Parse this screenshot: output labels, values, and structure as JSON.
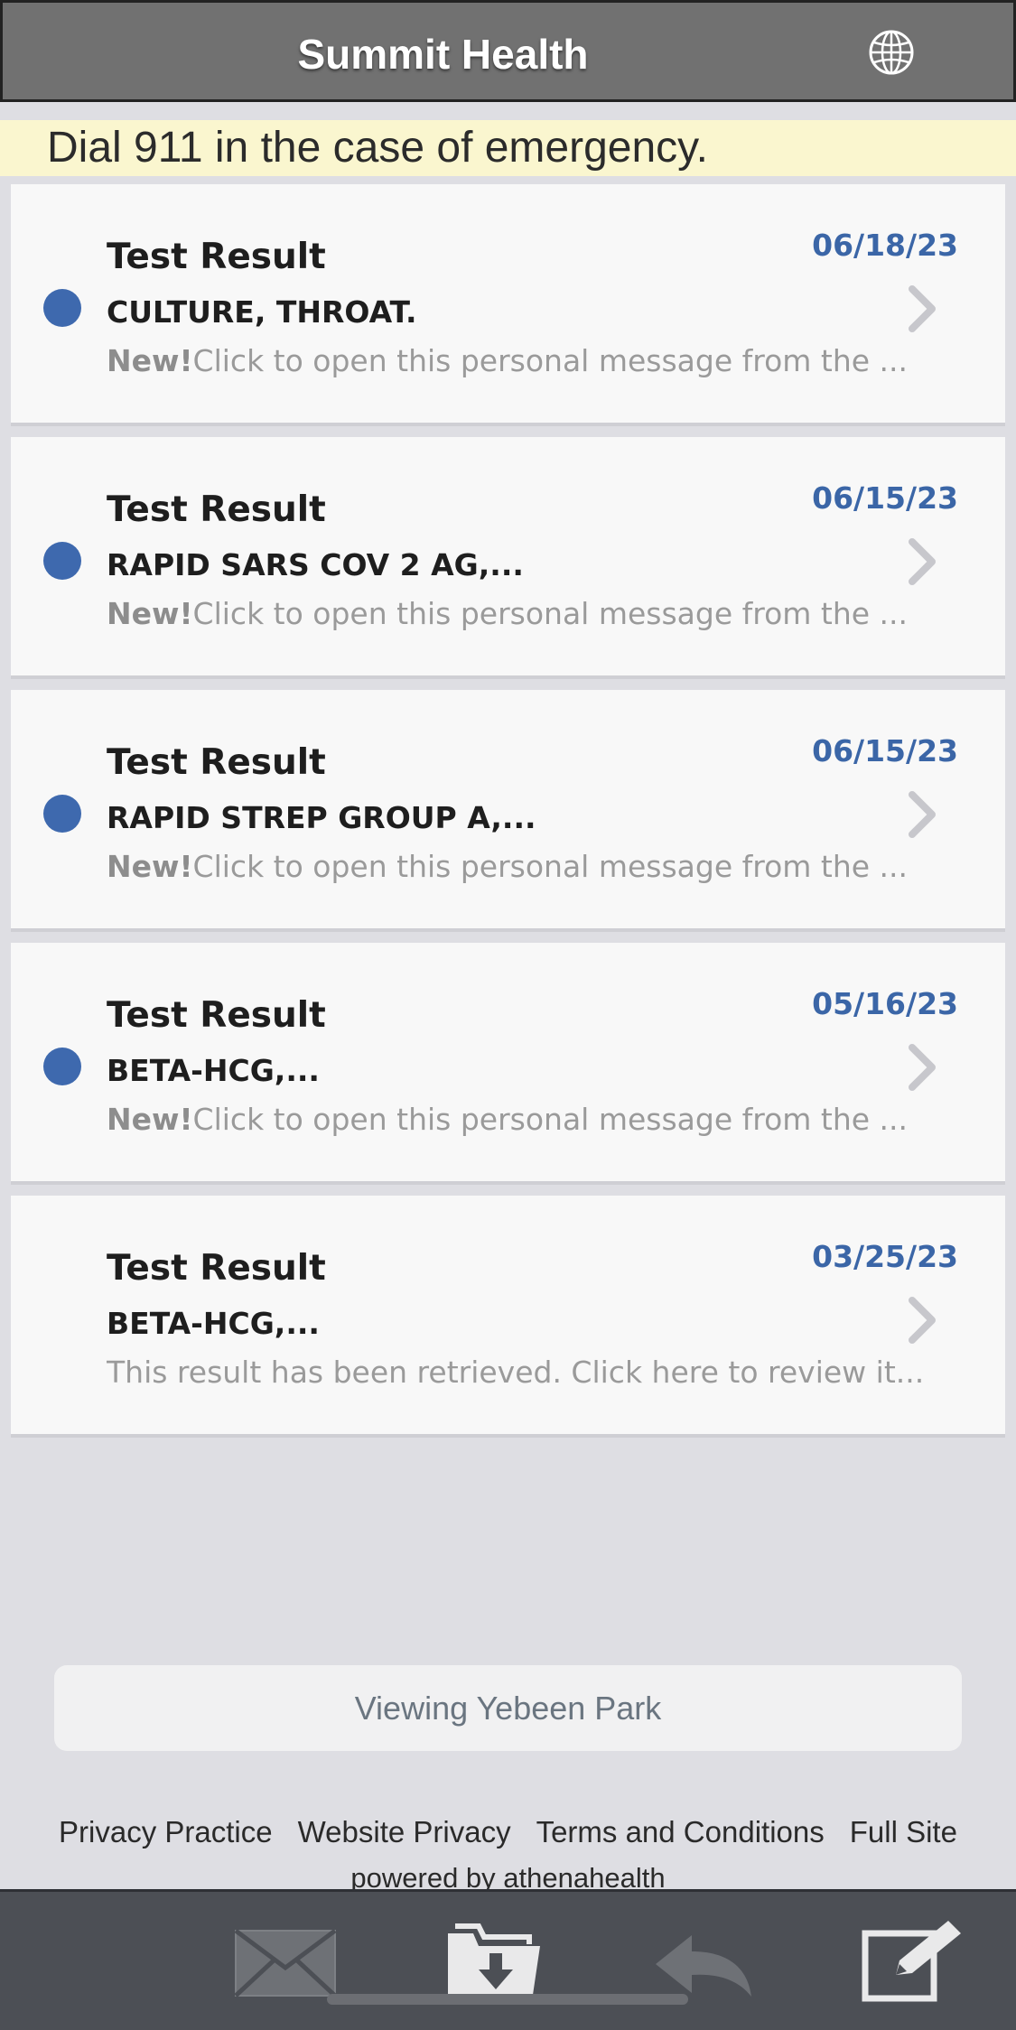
{
  "header": {
    "title": "Summit Health",
    "language_icon": "globe-icon"
  },
  "banner": {
    "text": "Dial 911 in the case of emergency."
  },
  "messages": [
    {
      "unread": true,
      "title": "Test Result",
      "subject": "CULTURE, THROAT.",
      "new_label": "New!",
      "preview": "Click to open this personal message from the ...",
      "date": "06/18/23"
    },
    {
      "unread": true,
      "title": "Test Result",
      "subject": "RAPID SARS COV 2 AG,...",
      "new_label": "New!",
      "preview": "Click to open this personal message from the ...",
      "date": "06/15/23"
    },
    {
      "unread": true,
      "title": "Test Result",
      "subject": "RAPID STREP GROUP A,...",
      "new_label": "New!",
      "preview": "Click to open this personal message from the ...",
      "date": "06/15/23"
    },
    {
      "unread": true,
      "title": "Test Result",
      "subject": "BETA-HCG,...",
      "new_label": "New!",
      "preview": "Click to open this personal message from the ...",
      "date": "05/16/23"
    },
    {
      "unread": false,
      "title": "Test Result",
      "subject": "BETA-HCG,...",
      "new_label": "",
      "preview": "This result has been retrieved. Click here to review it...",
      "date": "03/25/23"
    }
  ],
  "viewing": {
    "text": "Viewing Yebeen Park"
  },
  "footer": {
    "links": [
      "Privacy Practice",
      "Website Privacy",
      "Terms and Conditions",
      "Full Site"
    ],
    "powered": "powered by athenahealth"
  },
  "tabbar": {
    "icons": [
      "mail-icon",
      "folder-download-icon",
      "reply-icon",
      "compose-icon"
    ]
  },
  "colors": {
    "unread_dot": "#3e69ae",
    "date": "#3b66a7",
    "header_bg": "#717171",
    "banner_bg": "#faf6cf",
    "tabbar_bg": "#4c4f55"
  }
}
